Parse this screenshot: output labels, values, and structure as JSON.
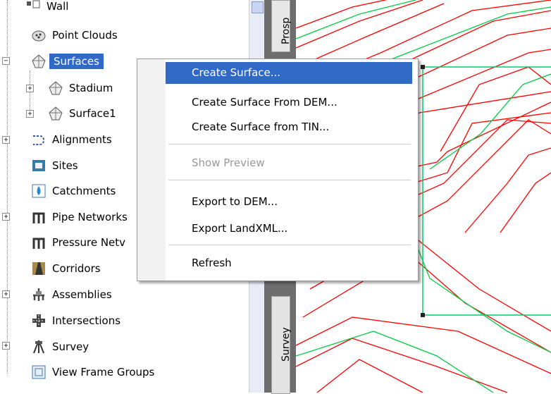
{
  "tree": {
    "items": [
      {
        "label": "Wall",
        "icon": "wall-icon"
      },
      {
        "label": "Point Clouds",
        "icon": "point-clouds-icon"
      },
      {
        "label": "Surfaces",
        "icon": "surfaces-icon"
      },
      {
        "label": "Stadium",
        "icon": "surface-icon"
      },
      {
        "label": "Surface1",
        "icon": "surface-icon"
      },
      {
        "label": "Alignments",
        "icon": "alignments-icon"
      },
      {
        "label": "Sites",
        "icon": "sites-icon"
      },
      {
        "label": "Catchments",
        "icon": "catchments-icon"
      },
      {
        "label": "Pipe Networks",
        "icon": "pipe-networks-icon"
      },
      {
        "label": "Pressure Netv",
        "icon": "pressure-networks-icon"
      },
      {
        "label": "Corridors",
        "icon": "corridors-icon"
      },
      {
        "label": "Assemblies",
        "icon": "assemblies-icon"
      },
      {
        "label": "Intersections",
        "icon": "intersections-icon"
      },
      {
        "label": "Survey",
        "icon": "survey-icon"
      },
      {
        "label": "View Frame Groups",
        "icon": "view-frame-groups-icon"
      }
    ]
  },
  "side_tabs": {
    "top": "Prosp",
    "bottom": "Survey"
  },
  "context_menu": {
    "items": [
      {
        "label": "Create Surface...",
        "state": "highlighted"
      },
      {
        "label": "Create Surface From DEM...",
        "state": "normal"
      },
      {
        "label": "Create Surface from TIN...",
        "state": "normal"
      },
      {
        "label": "Show Preview",
        "state": "disabled"
      },
      {
        "label": "Export to DEM...",
        "state": "normal"
      },
      {
        "label": "Export LandXML...",
        "state": "normal"
      },
      {
        "label": "Refresh",
        "state": "normal"
      }
    ]
  },
  "colors": {
    "selection": "#3169c6",
    "contour_major": "#ff0000",
    "contour_minor": "#00cc44",
    "boundary": "#00cc66"
  }
}
